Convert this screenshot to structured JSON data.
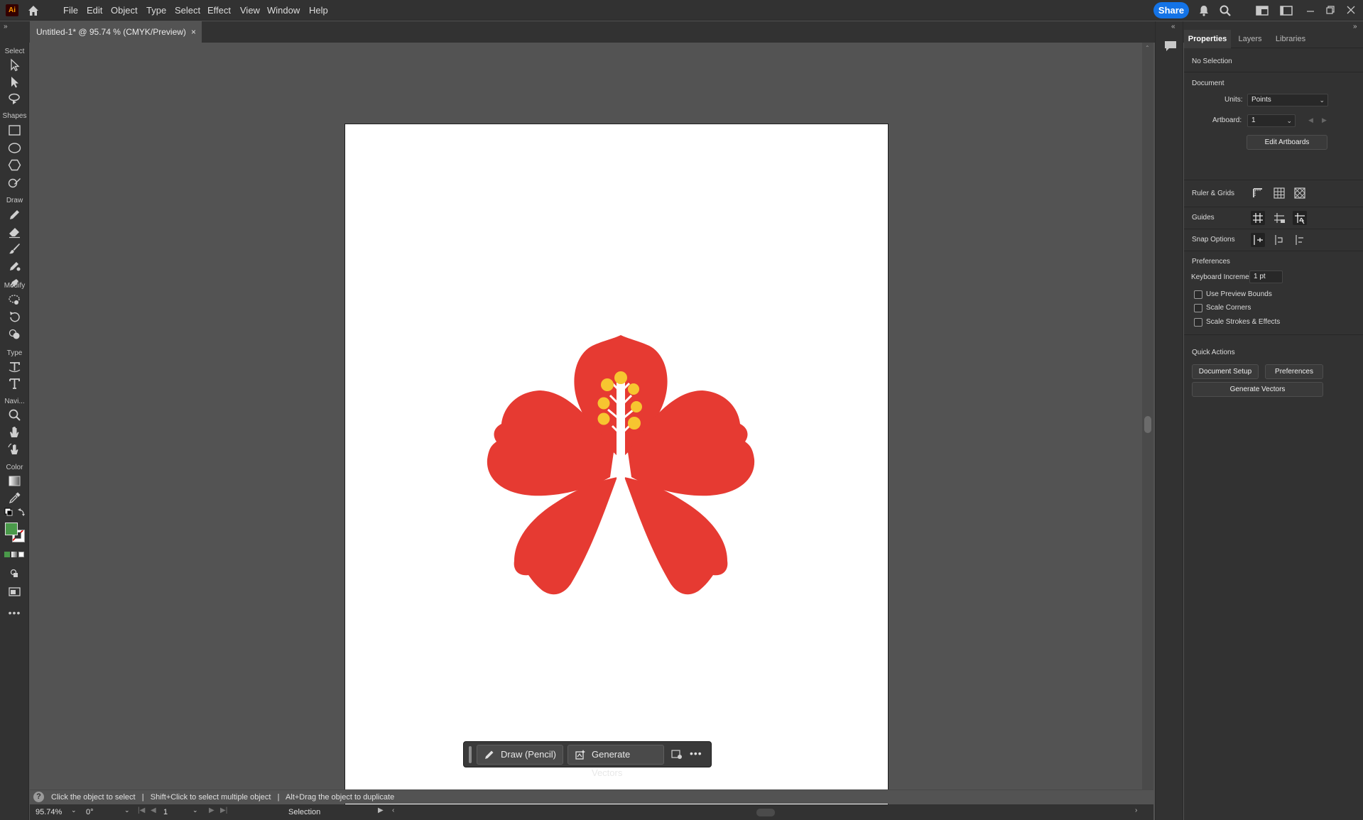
{
  "app": {
    "logo": "Ai",
    "menus": [
      "File",
      "Edit",
      "Object",
      "Type",
      "Select",
      "Effect",
      "View",
      "Window",
      "Help"
    ],
    "share_label": "Share",
    "icons": [
      "home-icon",
      "bell-icon",
      "search-icon",
      "workspace-icon",
      "panel-toggle-icon",
      "minimize-icon",
      "restore-icon",
      "close-icon"
    ]
  },
  "document": {
    "tab_title": "Untitled-1* @ 95.74 % (CMYK/Preview)",
    "tab_close": "×"
  },
  "toolbar": {
    "categories": {
      "select": "Select",
      "shapes": "Shapes",
      "draw": "Draw",
      "modify": "Modify",
      "type": "Type",
      "navigate": "Navi...",
      "color": "Color"
    },
    "more": "•••",
    "fill_color": "#4a9a4a"
  },
  "artwork": {
    "petal_color": "#e63a32",
    "stamen_color": "#f7c530",
    "style_color": "#ffffff"
  },
  "taskbar": {
    "draw_label": "Draw (Pencil)",
    "generate_label": "Generate Vectors",
    "more": "•••"
  },
  "statusbar": {
    "text": "Click the object to select   |   Shift+Click to select multiple object   |   Alt+Drag the object to duplicate",
    "help": "?"
  },
  "bottombar": {
    "zoom": "95.74%",
    "rotation": "0°",
    "artboard": "1",
    "tool": "Selection"
  },
  "panel": {
    "tabs": [
      "Properties",
      "Layers",
      "Libraries"
    ],
    "selection_state": "No Selection",
    "document": {
      "heading": "Document",
      "units_label": "Units:",
      "units_value": "Points",
      "artboard_label": "Artboard:",
      "artboard_value": "1",
      "edit_artboards": "Edit Artboards"
    },
    "ruler_grids": "Ruler & Grids",
    "guides": "Guides",
    "snap_options": "Snap Options",
    "preferences": {
      "heading": "Preferences",
      "keyboard_increment_label": "Keyboard Increment:",
      "keyboard_increment_value": "1 pt",
      "checkboxes": [
        "Use Preview Bounds",
        "Scale Corners",
        "Scale Strokes & Effects"
      ]
    },
    "quick_actions": {
      "heading": "Quick Actions",
      "document_setup": "Document Setup",
      "preferences": "Preferences",
      "generate_vectors": "Generate Vectors"
    }
  }
}
